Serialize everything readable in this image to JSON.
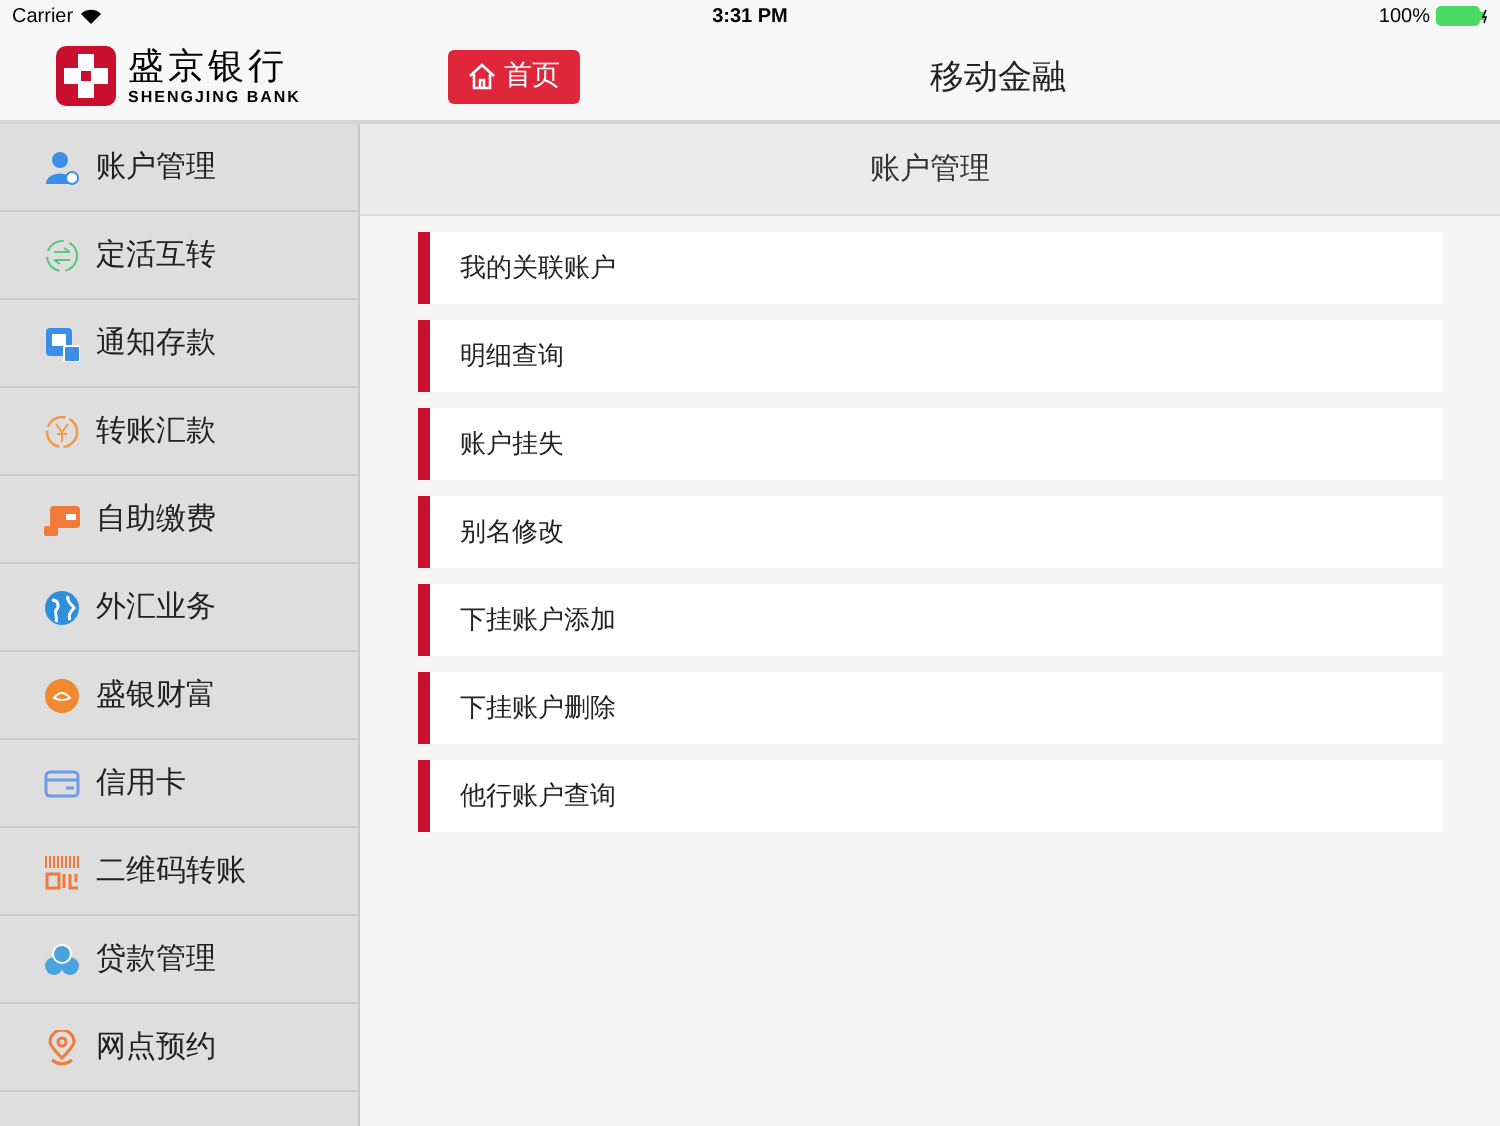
{
  "status_bar": {
    "carrier": "Carrier",
    "time": "3:31 PM",
    "battery": "100%"
  },
  "header": {
    "logo_name": "盛京银行",
    "logo_sub": "SHENGJING BANK",
    "home_button": "首页",
    "title": "移动金融"
  },
  "sidebar": {
    "items": [
      {
        "label": "账户管理",
        "kind": "user",
        "color": "#3a8ee6"
      },
      {
        "label": "定活互转",
        "kind": "swap",
        "color": "#5cc77a"
      },
      {
        "label": "通知存款",
        "kind": "deposit",
        "color": "#3a8ee6"
      },
      {
        "label": "转账汇款",
        "kind": "yen",
        "color": "#f39a4a"
      },
      {
        "label": "自助缴费",
        "kind": "wallet",
        "color": "#f07a3a"
      },
      {
        "label": "外汇业务",
        "kind": "globe",
        "color": "#2f8fdc"
      },
      {
        "label": "盛银财富",
        "kind": "wealth",
        "color": "#f08a30"
      },
      {
        "label": "信用卡",
        "kind": "card",
        "color": "#6c9be8"
      },
      {
        "label": "二维码转账",
        "kind": "qr",
        "color": "#f07a3a"
      },
      {
        "label": "贷款管理",
        "kind": "coins",
        "color": "#4aa3df"
      },
      {
        "label": "网点预约",
        "kind": "pin",
        "color": "#f07a3a"
      }
    ]
  },
  "content": {
    "title": "账户管理",
    "items": [
      "我的关联账户",
      "明细查询",
      "账户挂失",
      "别名修改",
      "下挂账户添加",
      "下挂账户删除",
      "他行账户查询"
    ]
  }
}
